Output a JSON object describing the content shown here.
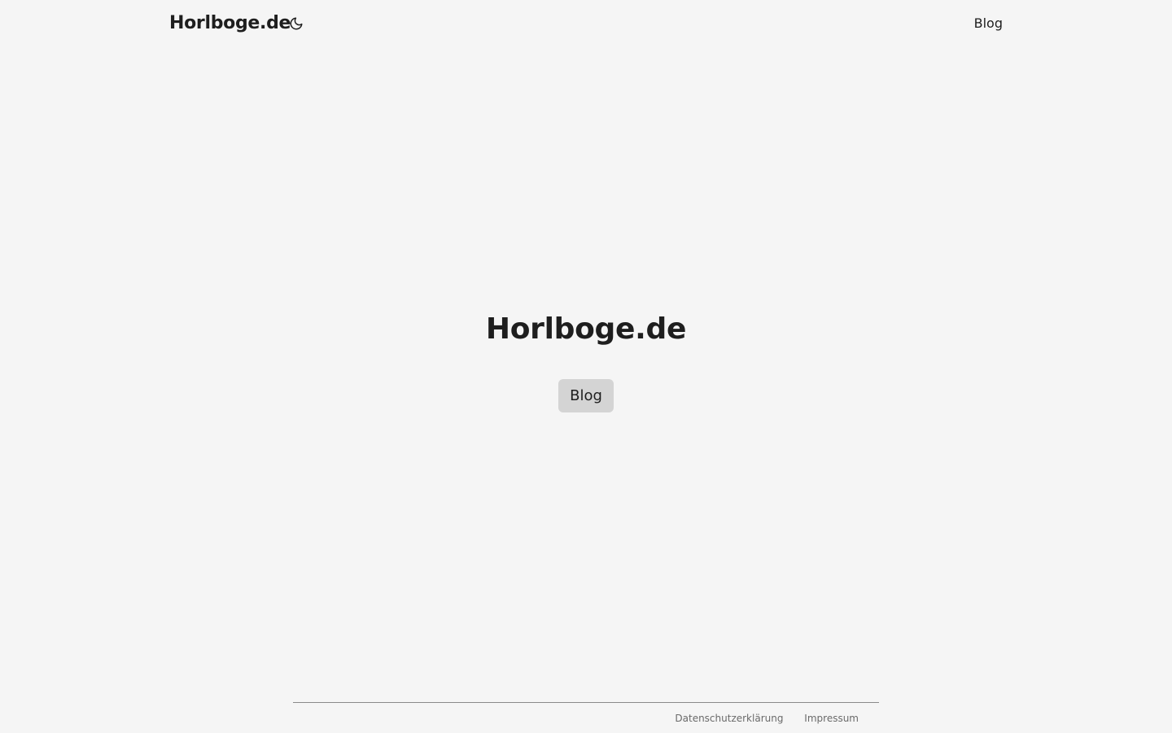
{
  "header": {
    "site_title": "Horlboge.de",
    "theme_toggle_icon": "moon-icon",
    "nav": [
      {
        "label": "Blog"
      }
    ]
  },
  "hero": {
    "title": "Horlboge.de",
    "button_label": "Blog"
  },
  "footer": {
    "links": [
      {
        "label": "Datenschutzerklärung"
      },
      {
        "label": "Impressum"
      }
    ]
  },
  "colors": {
    "background": "#f5f5f5",
    "text": "#1e1e1e",
    "button_bg": "#d4d4d4",
    "footer_text": "#6a6a6a"
  }
}
